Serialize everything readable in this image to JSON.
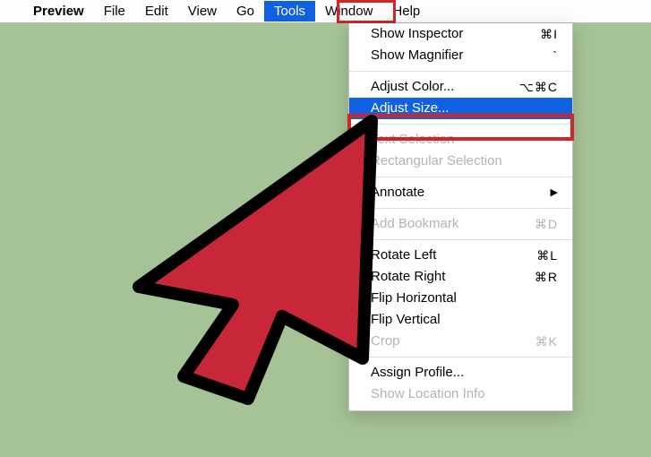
{
  "menubar": {
    "app_name": "Preview",
    "items": [
      "File",
      "Edit",
      "View",
      "Go",
      "Tools",
      "Window",
      "Help"
    ],
    "selected": "Tools"
  },
  "dropdown": {
    "groups": [
      [
        {
          "label": "Show Inspector",
          "shortcut": "⌘I",
          "disabled": false
        },
        {
          "label": "Show Magnifier",
          "shortcut": "`",
          "disabled": false
        }
      ],
      [
        {
          "label": "Adjust Color...",
          "shortcut": "⌥⌘C",
          "disabled": false
        },
        {
          "label": "Adjust Size...",
          "shortcut": "",
          "disabled": false,
          "selected": true
        }
      ],
      [
        {
          "label": "Text Selection",
          "shortcut": "",
          "disabled": true
        },
        {
          "label": "Rectangular Selection",
          "shortcut": "",
          "disabled": true
        }
      ],
      [
        {
          "label": "Annotate",
          "shortcut": "",
          "disabled": false,
          "submenu": true
        }
      ],
      [
        {
          "label": "Add Bookmark",
          "shortcut": "⌘D",
          "disabled": true
        }
      ],
      [
        {
          "label": "Rotate Left",
          "shortcut": "⌘L",
          "disabled": false
        },
        {
          "label": "Rotate Right",
          "shortcut": "⌘R",
          "disabled": false
        },
        {
          "label": "Flip Horizontal",
          "shortcut": "",
          "disabled": false
        },
        {
          "label": "Flip Vertical",
          "shortcut": "",
          "disabled": false
        },
        {
          "label": "Crop",
          "shortcut": "⌘K",
          "disabled": true
        }
      ],
      [
        {
          "label": "Assign Profile...",
          "shortcut": "",
          "disabled": false
        },
        {
          "label": "Show Location Info",
          "shortcut": "",
          "disabled": true
        }
      ]
    ]
  },
  "colors": {
    "highlight_red": "#d02626",
    "selection_blue": "#1061e2"
  }
}
